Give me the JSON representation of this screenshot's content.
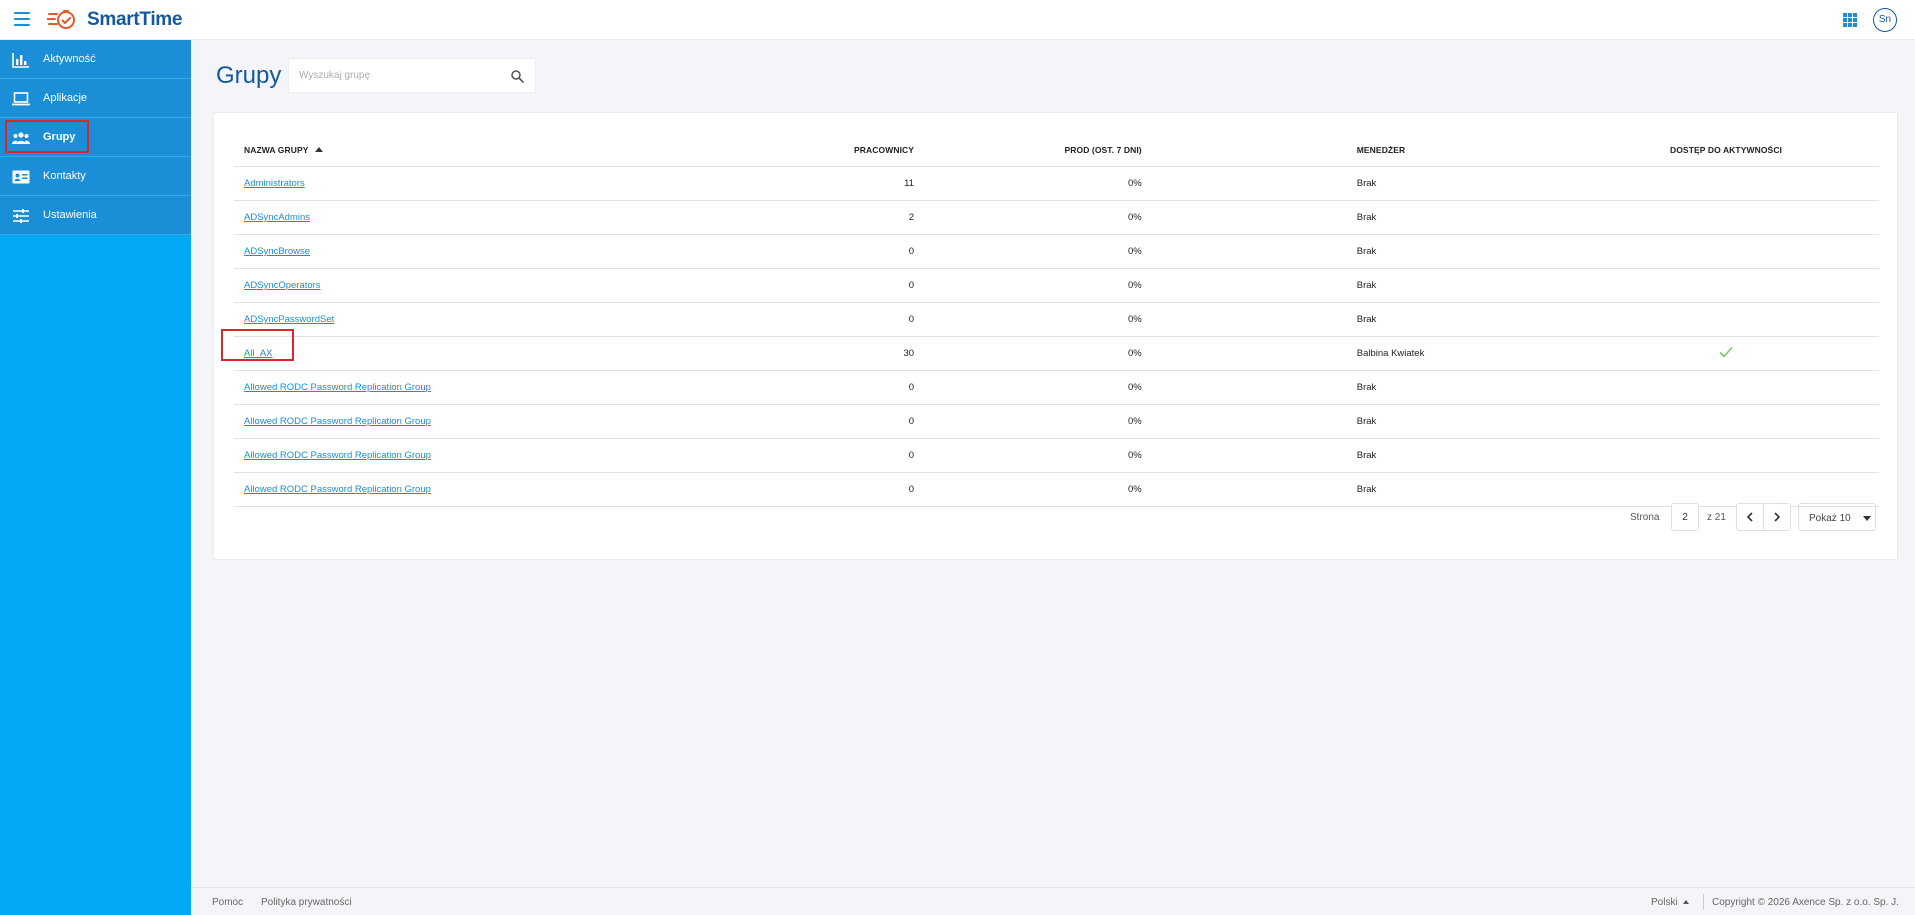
{
  "app": {
    "name": "SmartTime",
    "user_initials": "Sn"
  },
  "sidebar": {
    "items": [
      {
        "label": "Aktywność",
        "icon": "bar-chart-icon",
        "active": false
      },
      {
        "label": "Aplikacje",
        "icon": "laptop-icon",
        "active": false
      },
      {
        "label": "Grupy",
        "icon": "people-icon",
        "active": true
      },
      {
        "label": "Kontakty",
        "icon": "contact-card-icon",
        "active": false
      },
      {
        "label": "Ustawienia",
        "icon": "sliders-icon",
        "active": false
      }
    ]
  },
  "page": {
    "title": "Grupy",
    "search_placeholder": "Wyszukaj grupę",
    "search_value": ""
  },
  "table": {
    "columns": [
      "Nazwa grupy",
      "Pracownicy",
      "Prod (ost. 7 dni)",
      "Menedżer",
      "Dostęp do aktywności"
    ],
    "sort_column": "Nazwa grupy",
    "sort_direction": "ascending",
    "rows": [
      {
        "name": "Administrators",
        "employees": "11",
        "prod": "0%",
        "manager": "Brak",
        "access": false
      },
      {
        "name": "ADSyncAdmins",
        "employees": "2",
        "prod": "0%",
        "manager": "Brak",
        "access": false
      },
      {
        "name": "ADSyncBrowse",
        "employees": "0",
        "prod": "0%",
        "manager": "Brak",
        "access": false
      },
      {
        "name": "ADSyncOperators",
        "employees": "0",
        "prod": "0%",
        "manager": "Brak",
        "access": false
      },
      {
        "name": "ADSyncPasswordSet",
        "employees": "0",
        "prod": "0%",
        "manager": "Brak",
        "access": false
      },
      {
        "name": "All_AX",
        "employees": "30",
        "prod": "0%",
        "manager": "Balbina Kwiatek",
        "access": true
      },
      {
        "name": "Allowed RODC Password Replication Group",
        "employees": "0",
        "prod": "0%",
        "manager": "Brak",
        "access": false
      },
      {
        "name": "Allowed RODC Password Replication Group",
        "employees": "0",
        "prod": "0%",
        "manager": "Brak",
        "access": false
      },
      {
        "name": "Allowed RODC Password Replication Group",
        "employees": "0",
        "prod": "0%",
        "manager": "Brak",
        "access": false
      },
      {
        "name": "Allowed RODC Password Replication Group",
        "employees": "0",
        "prod": "0%",
        "manager": "Brak",
        "access": false
      }
    ]
  },
  "pagination": {
    "page_label": "Strona",
    "current_page": "2",
    "total_label": "z 21",
    "show_label": "Pokaż 10"
  },
  "footer": {
    "help": "Pomoc",
    "privacy": "Polityka prywatności",
    "language": "Polski",
    "copyright": "Copyright © 2026 Axence Sp. z o.o. Sp. J."
  },
  "colors": {
    "brand_dark": "#14589e",
    "sidebar_bg": "#03a9f4",
    "nav_item_bg": "#1a8ed6",
    "link": "#1a8ed6",
    "check": "#7cc46a",
    "highlight": "#d7262e"
  }
}
